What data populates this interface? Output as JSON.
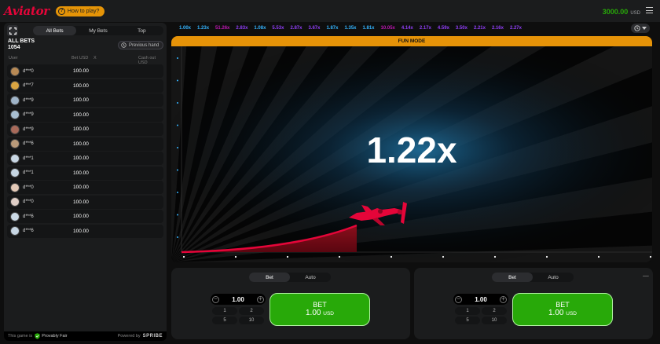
{
  "header": {
    "logo": "Aviator",
    "how_to_play": "How to play?",
    "balance": "3000.00",
    "currency": "USD"
  },
  "left_panel": {
    "tabs": [
      "All Bets",
      "My Bets",
      "Top"
    ],
    "title": "ALL BETS",
    "count": "1054",
    "previous_hand": "Previous hand",
    "columns": {
      "user": "User",
      "bet": "Bet USD",
      "x": "X",
      "cashout": "Cash out USD"
    },
    "bets": [
      {
        "user": "d***0",
        "bet": "100.00",
        "avatar_color": "#b88a55"
      },
      {
        "user": "d***7",
        "bet": "100.00",
        "avatar_color": "#d9a441"
      },
      {
        "user": "d***9",
        "bet": "100.00",
        "avatar_color": "#9fb4c8"
      },
      {
        "user": "d***9",
        "bet": "100.00",
        "avatar_color": "#a9bfd1"
      },
      {
        "user": "d***9",
        "bet": "100.00",
        "avatar_color": "#a86a5a"
      },
      {
        "user": "d***6",
        "bet": "100.00",
        "avatar_color": "#b99a7a"
      },
      {
        "user": "d***1",
        "bet": "100.00",
        "avatar_color": "#c9d7e4"
      },
      {
        "user": "d***1",
        "bet": "100.00",
        "avatar_color": "#c6d5e2"
      },
      {
        "user": "d***0",
        "bet": "100.00",
        "avatar_color": "#e3c9b7"
      },
      {
        "user": "d***0",
        "bet": "100.00",
        "avatar_color": "#e0cfc7"
      },
      {
        "user": "d***6",
        "bet": "100.00",
        "avatar_color": "#cbd9e6"
      },
      {
        "user": "d***6",
        "bet": "100.00",
        "avatar_color": "#c7d6e3"
      }
    ],
    "footer": {
      "fair_prefix": "This game is",
      "fair_label": "Provably Fair",
      "powered": "Powered by",
      "brand": "SPRIBE"
    }
  },
  "history": [
    {
      "value": "1.00x",
      "color": "#34b4ff"
    },
    {
      "value": "1.23x",
      "color": "#34b4ff"
    },
    {
      "value": "51.26x",
      "color": "#c017b4"
    },
    {
      "value": "2.83x",
      "color": "#913ef8"
    },
    {
      "value": "1.08x",
      "color": "#34b4ff"
    },
    {
      "value": "5.53x",
      "color": "#913ef8"
    },
    {
      "value": "2.87x",
      "color": "#913ef8"
    },
    {
      "value": "3.67x",
      "color": "#913ef8"
    },
    {
      "value": "1.87x",
      "color": "#34b4ff"
    },
    {
      "value": "1.35x",
      "color": "#34b4ff"
    },
    {
      "value": "1.81x",
      "color": "#34b4ff"
    },
    {
      "value": "10.05x",
      "color": "#c017b4"
    },
    {
      "value": "4.14x",
      "color": "#913ef8"
    },
    {
      "value": "2.17x",
      "color": "#913ef8"
    },
    {
      "value": "4.59x",
      "color": "#913ef8"
    },
    {
      "value": "3.50x",
      "color": "#913ef8"
    },
    {
      "value": "2.21x",
      "color": "#913ef8"
    },
    {
      "value": "2.16x",
      "color": "#913ef8"
    },
    {
      "value": "2.27x",
      "color": "#913ef8"
    }
  ],
  "game": {
    "mode_label": "FUN MODE",
    "multiplier": "1.22x"
  },
  "bet_panels": [
    {
      "tabs": [
        "Bet",
        "Auto"
      ],
      "amount": "1.00",
      "quick": [
        "1",
        "2",
        "5",
        "10"
      ],
      "button_label": "BET",
      "button_amount": "1.00",
      "button_currency": "USD"
    },
    {
      "tabs": [
        "Bet",
        "Auto"
      ],
      "amount": "1.00",
      "quick": [
        "1",
        "2",
        "5",
        "10"
      ],
      "button_label": "BET",
      "button_amount": "1.00",
      "button_currency": "USD"
    }
  ],
  "colors": {
    "brand_red": "#e50539",
    "accent_orange": "#e69308",
    "bet_green": "#28a909"
  }
}
